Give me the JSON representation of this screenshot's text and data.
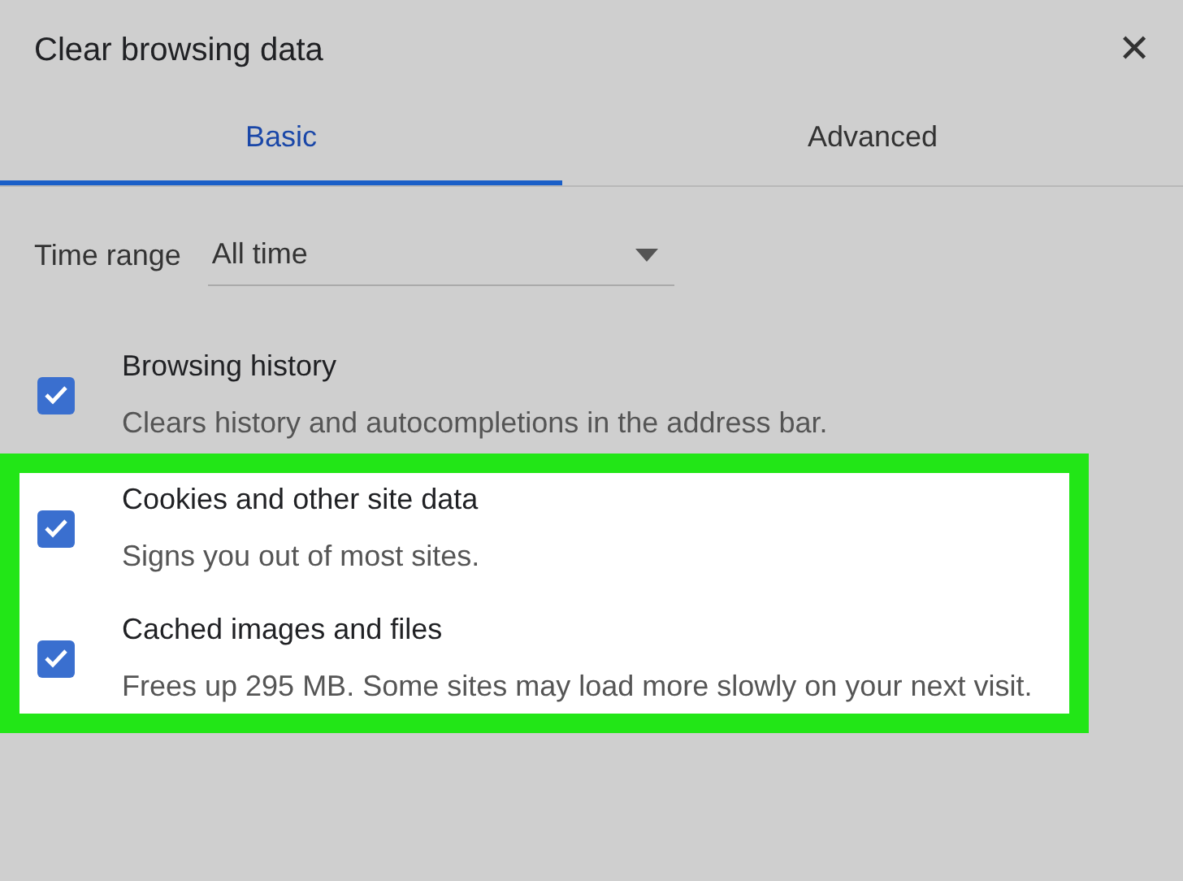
{
  "window": {
    "title": "Clear browsing data",
    "close": "✕"
  },
  "tabs": [
    {
      "label": "Basic",
      "selected": true
    },
    {
      "label": "Advanced",
      "selected": false
    }
  ],
  "time_range": {
    "label": "Time range",
    "value": "All time"
  },
  "items": [
    {
      "title": "Browsing history",
      "description": "Clears history and autocompletions in the address bar.",
      "checked": true,
      "highlighted": false
    },
    {
      "title": "Cookies and other site data",
      "description": "Signs you out of most sites.",
      "checked": true,
      "highlighted": true
    },
    {
      "title": "Cached images and files",
      "description": "Frees up 295 MB. Some sites may load more slowly on your next visit.",
      "checked": true,
      "highlighted": true
    }
  ]
}
